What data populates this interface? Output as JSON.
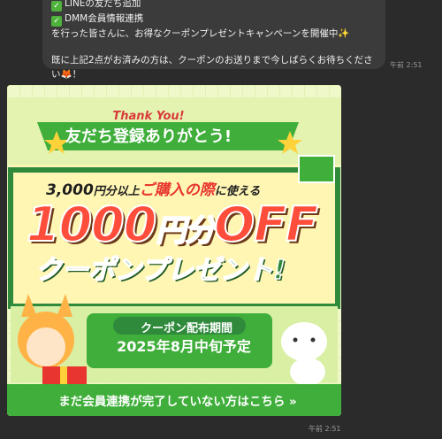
{
  "message": {
    "line1": "LINEの友だち追加",
    "line2": "DMM会員情報連携",
    "line3": "を行った皆さんに、お得なクーポンプレゼントキャンペーンを開催中✨",
    "line4": "既に上記2点がお済みの方は、クーポンのお送りまで今しばらくお待ちください🦊！",
    "time": "午前 2:51"
  },
  "banner": {
    "thanks": "Thank You!",
    "title": "友だち登録ありがとう!",
    "line1_amount": "3,000",
    "line1_mid": "円分以上",
    "line1_red": "ご購入の際",
    "line1_end": "に使える",
    "discount_amount": "1000",
    "discount_unit": "円分",
    "discount_off": "OFF",
    "present": "クーポンプレゼント!",
    "period_label": "クーポン配布期間",
    "period": "2025年8月中旬予定",
    "cta": "まだ会員連携が完了していない方はこちら »",
    "time": "午前 2:51"
  },
  "colors": {
    "bg": "#2b2b2b",
    "bubble": "#3b3b3b",
    "green": "#3fae3a",
    "dark_green": "#2f8a3b",
    "red": "#e8352f"
  }
}
